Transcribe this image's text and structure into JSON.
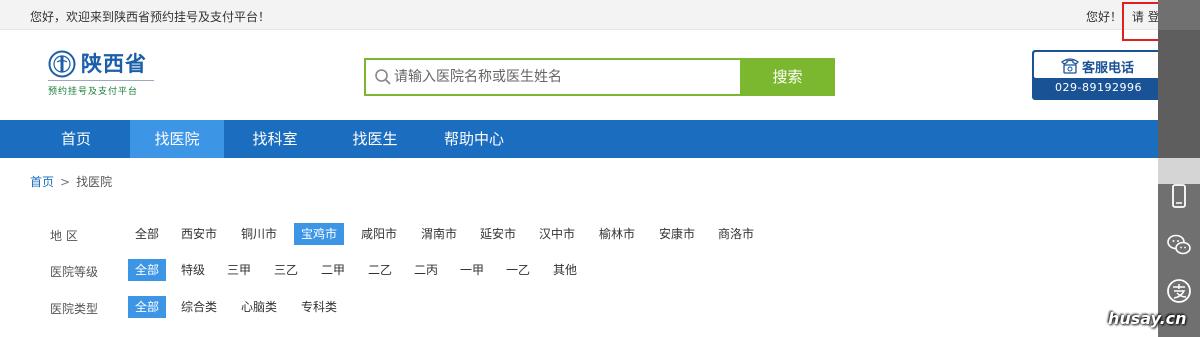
{
  "topbar": {
    "welcome": "您好，欢迎来到陕西省预约挂号及支付平台！",
    "greeting": "您好！",
    "login_prefix": "请",
    "login_label": "登录"
  },
  "logo": {
    "province": "陕西省",
    "subtitle": "预约挂号及支付平台"
  },
  "search": {
    "placeholder": "请输入医院名称或医生姓名",
    "button_label": "搜索"
  },
  "service": {
    "label": "客服电话",
    "phone": "029-89192996"
  },
  "nav": {
    "items": [
      {
        "label": "首页",
        "active": false
      },
      {
        "label": "找医院",
        "active": true
      },
      {
        "label": "找科室",
        "active": false
      },
      {
        "label": "找医生",
        "active": false
      },
      {
        "label": "帮助中心",
        "active": false
      }
    ]
  },
  "breadcrumb": {
    "home": "首页",
    "separator": ">",
    "current": "找医院"
  },
  "filters": {
    "region": {
      "label": "地 区",
      "options": [
        "全部",
        "西安市",
        "铜川市",
        "宝鸡市",
        "咸阳市",
        "渭南市",
        "延安市",
        "汉中市",
        "榆林市",
        "安康市",
        "商洛市"
      ],
      "selected": "宝鸡市"
    },
    "level": {
      "label": "医院等级",
      "options": [
        "全部",
        "特级",
        "三甲",
        "三乙",
        "二甲",
        "二乙",
        "二丙",
        "一甲",
        "一乙",
        "其他"
      ],
      "selected": "全部"
    },
    "type": {
      "label": "医院类型",
      "options": [
        "全部",
        "综合类",
        "心脑类",
        "专科类"
      ],
      "selected": "全部"
    }
  },
  "sidebar": {
    "icons": [
      "mobile-icon",
      "wechat-icon",
      "alipay-icon"
    ]
  },
  "watermark": "husay.cn",
  "colors": {
    "nav_blue": "#1b6dbf",
    "active_blue": "#3d95e6",
    "search_green": "#7cb82f",
    "service_blue": "#1a5296"
  }
}
